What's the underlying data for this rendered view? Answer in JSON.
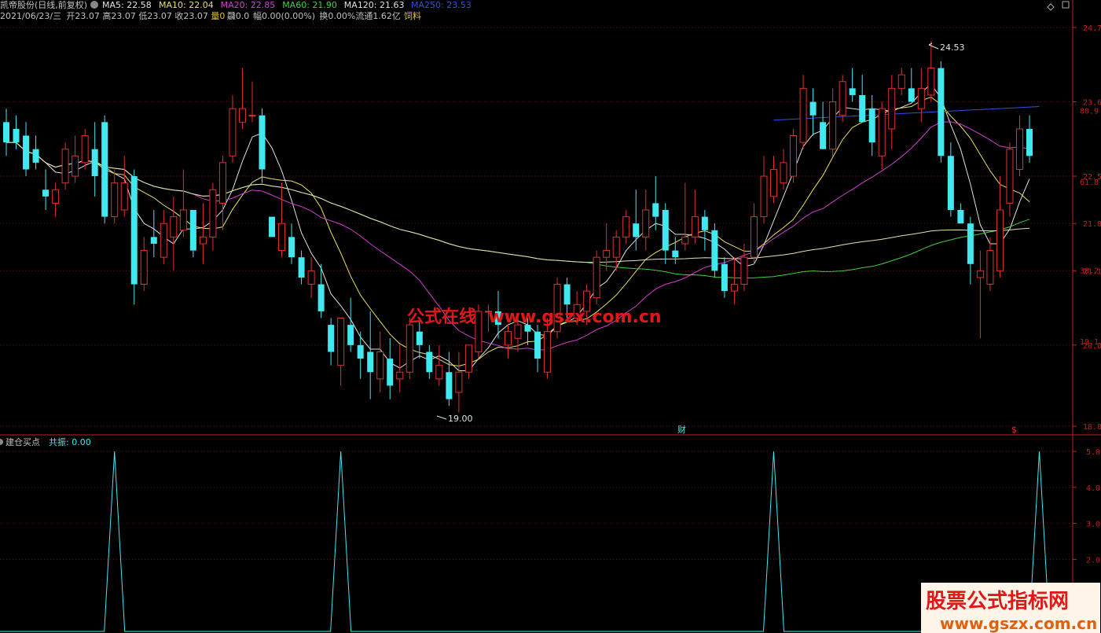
{
  "header": {
    "title": "凯帝股份(日线,前复权)",
    "ma_values": [
      {
        "label": "MA5: 22.58",
        "color": "#e0e0e0"
      },
      {
        "label": "MA10: 22.04",
        "color": "#e8e060"
      },
      {
        "label": "MA20: 22.85",
        "color": "#d040d0"
      },
      {
        "label": "MA60: 21.90",
        "color": "#40d040"
      },
      {
        "label": "MA120: 21.63",
        "color": "#e0e0e0"
      },
      {
        "label": "MA250: 23.53",
        "color": "#3050e0"
      }
    ],
    "info_line": [
      {
        "text": "2021/06/23/三",
        "color": "#c0c0c0"
      },
      {
        "text": "开23.07",
        "color": "#c0c0c0"
      },
      {
        "text": "高23.07",
        "color": "#c0c0c0"
      },
      {
        "text": "低23.07",
        "color": "#c0c0c0"
      },
      {
        "text": "收23.07",
        "color": "#c0c0c0"
      },
      {
        "text": "量0",
        "color": "#e0c040"
      },
      {
        "text": "飝0.0",
        "color": "#c0c0c0"
      },
      {
        "text": "幅0.00(0.00%)",
        "color": "#c0c0c0"
      },
      {
        "text": "换0.00%",
        "color": "#c0c0c0"
      },
      {
        "text": "流通1.62亿",
        "color": "#c0c0c0"
      },
      {
        "text": "饲料",
        "color": "#e0c040"
      }
    ]
  },
  "indicator": {
    "name": "建仓买点",
    "value_text": "共振: 0.00"
  },
  "annotations": {
    "high_label": "24.53",
    "low_label": "19.00",
    "finance_marker": "财",
    "dollar_marker": "$",
    "watermark_center": "公式在线  www.gszx.com.cn",
    "watermark_corner_title": "股票公式指标网",
    "watermark_corner_url": "www.gszx.com.cn"
  },
  "colors": {
    "up": "#e03030",
    "down": "#40e8f0",
    "grid": "#701010",
    "axis": "#c81e1e"
  },
  "chart_data": [
    {
      "type": "candlestick",
      "price_axis_ticks": [
        "24.7",
        "23.6",
        "22.5",
        "21.8",
        "21.1",
        "20.0",
        "18.8"
      ],
      "fib_ticks": [
        "80.9",
        "61.8",
        "38.2",
        "19.1"
      ],
      "ylim": [
        18.8,
        24.7
      ],
      "candles": [
        {
          "o": 23.3,
          "h": 23.5,
          "l": 22.8,
          "c": 23.0
        },
        {
          "o": 23.2,
          "h": 23.4,
          "l": 22.9,
          "c": 23.0
        },
        {
          "o": 23.1,
          "h": 23.3,
          "l": 22.5,
          "c": 22.6
        },
        {
          "o": 22.9,
          "h": 23.1,
          "l": 22.6,
          "c": 22.7
        },
        {
          "o": 22.3,
          "h": 22.6,
          "l": 22.0,
          "c": 22.2
        },
        {
          "o": 22.1,
          "h": 22.4,
          "l": 21.9,
          "c": 22.3
        },
        {
          "o": 22.4,
          "h": 23.0,
          "l": 22.3,
          "c": 22.9
        },
        {
          "o": 22.5,
          "h": 23.1,
          "l": 22.4,
          "c": 22.8
        },
        {
          "o": 22.7,
          "h": 23.2,
          "l": 22.6,
          "c": 23.1
        },
        {
          "o": 22.9,
          "h": 23.3,
          "l": 22.2,
          "c": 22.5
        },
        {
          "o": 23.3,
          "h": 23.4,
          "l": 21.8,
          "c": 21.9
        },
        {
          "o": 21.9,
          "h": 22.6,
          "l": 21.8,
          "c": 22.4
        },
        {
          "o": 22.0,
          "h": 22.8,
          "l": 21.9,
          "c": 22.4
        },
        {
          "o": 22.5,
          "h": 22.6,
          "l": 20.6,
          "c": 20.9
        },
        {
          "o": 20.9,
          "h": 21.6,
          "l": 20.8,
          "c": 21.4
        },
        {
          "o": 21.6,
          "h": 22.0,
          "l": 21.3,
          "c": 21.5
        },
        {
          "o": 21.3,
          "h": 22.0,
          "l": 21.2,
          "c": 21.8
        },
        {
          "o": 21.6,
          "h": 22.2,
          "l": 21.1,
          "c": 21.9
        },
        {
          "o": 21.7,
          "h": 22.6,
          "l": 21.6,
          "c": 22.0
        },
        {
          "o": 22.0,
          "h": 22.0,
          "l": 21.3,
          "c": 21.4
        },
        {
          "o": 21.5,
          "h": 22.1,
          "l": 21.2,
          "c": 21.6
        },
        {
          "o": 21.6,
          "h": 22.4,
          "l": 21.4,
          "c": 22.3
        },
        {
          "o": 22.1,
          "h": 22.8,
          "l": 21.7,
          "c": 22.7
        },
        {
          "o": 22.8,
          "h": 23.7,
          "l": 22.7,
          "c": 23.5
        },
        {
          "o": 23.3,
          "h": 24.1,
          "l": 23.2,
          "c": 23.5
        },
        {
          "o": 23.4,
          "h": 23.9,
          "l": 23.3,
          "c": 23.4
        },
        {
          "o": 23.4,
          "h": 23.5,
          "l": 22.4,
          "c": 22.6
        },
        {
          "o": 21.9,
          "h": 21.9,
          "l": 21.6,
          "c": 21.6
        },
        {
          "o": 21.4,
          "h": 22.4,
          "l": 21.3,
          "c": 21.8
        },
        {
          "o": 21.6,
          "h": 21.8,
          "l": 21.2,
          "c": 21.3
        },
        {
          "o": 21.3,
          "h": 21.4,
          "l": 20.9,
          "c": 21.0
        },
        {
          "o": 20.9,
          "h": 21.3,
          "l": 20.7,
          "c": 21.1
        },
        {
          "o": 20.9,
          "h": 21.2,
          "l": 20.4,
          "c": 20.5
        },
        {
          "o": 20.3,
          "h": 20.4,
          "l": 19.7,
          "c": 19.9
        },
        {
          "o": 19.7,
          "h": 20.4,
          "l": 19.4,
          "c": 20.4
        },
        {
          "o": 20.3,
          "h": 20.7,
          "l": 19.9,
          "c": 20.0
        },
        {
          "o": 20.0,
          "h": 20.2,
          "l": 19.5,
          "c": 19.8
        },
        {
          "o": 19.9,
          "h": 20.5,
          "l": 19.2,
          "c": 19.6
        },
        {
          "o": 19.5,
          "h": 20.2,
          "l": 19.3,
          "c": 19.9
        },
        {
          "o": 19.8,
          "h": 20.1,
          "l": 19.2,
          "c": 19.4
        },
        {
          "o": 19.5,
          "h": 20.0,
          "l": 19.3,
          "c": 19.6
        },
        {
          "o": 19.6,
          "h": 20.4,
          "l": 19.5,
          "c": 20.3
        },
        {
          "o": 20.2,
          "h": 20.4,
          "l": 19.8,
          "c": 20.0
        },
        {
          "o": 19.9,
          "h": 20.0,
          "l": 19.5,
          "c": 19.6
        },
        {
          "o": 19.5,
          "h": 20.0,
          "l": 19.4,
          "c": 19.7
        },
        {
          "o": 19.6,
          "h": 19.9,
          "l": 19.1,
          "c": 19.2
        },
        {
          "o": 19.3,
          "h": 19.9,
          "l": 19.0,
          "c": 19.6
        },
        {
          "o": 19.6,
          "h": 20.0,
          "l": 19.5,
          "c": 20.0
        },
        {
          "o": 19.9,
          "h": 20.6,
          "l": 19.8,
          "c": 20.5
        },
        {
          "o": 20.5,
          "h": 20.6,
          "l": 20.2,
          "c": 20.5
        },
        {
          "o": 20.5,
          "h": 20.8,
          "l": 20.1,
          "c": 20.3
        },
        {
          "o": 20.0,
          "h": 20.3,
          "l": 19.8,
          "c": 20.2
        },
        {
          "o": 20.1,
          "h": 20.4,
          "l": 19.9,
          "c": 20.3
        },
        {
          "o": 20.3,
          "h": 20.4,
          "l": 20.0,
          "c": 20.2
        },
        {
          "o": 20.2,
          "h": 20.3,
          "l": 19.6,
          "c": 19.8
        },
        {
          "o": 19.6,
          "h": 20.4,
          "l": 19.5,
          "c": 20.2
        },
        {
          "o": 20.2,
          "h": 21.0,
          "l": 20.1,
          "c": 20.9
        },
        {
          "o": 20.9,
          "h": 21.0,
          "l": 20.4,
          "c": 20.6
        },
        {
          "o": 20.4,
          "h": 20.8,
          "l": 20.3,
          "c": 20.6
        },
        {
          "o": 20.5,
          "h": 20.9,
          "l": 20.3,
          "c": 20.8
        },
        {
          "o": 20.7,
          "h": 21.4,
          "l": 20.6,
          "c": 21.3
        },
        {
          "o": 21.3,
          "h": 21.8,
          "l": 21.1,
          "c": 21.4
        },
        {
          "o": 21.3,
          "h": 21.7,
          "l": 21.1,
          "c": 21.6
        },
        {
          "o": 21.6,
          "h": 22.0,
          "l": 21.5,
          "c": 21.9
        },
        {
          "o": 21.8,
          "h": 22.3,
          "l": 21.4,
          "c": 21.6
        },
        {
          "o": 21.6,
          "h": 22.3,
          "l": 21.4,
          "c": 22.0
        },
        {
          "o": 22.1,
          "h": 22.5,
          "l": 21.7,
          "c": 21.9
        },
        {
          "o": 22.0,
          "h": 22.1,
          "l": 21.2,
          "c": 21.4
        },
        {
          "o": 21.4,
          "h": 21.6,
          "l": 21.2,
          "c": 21.3
        },
        {
          "o": 21.5,
          "h": 22.4,
          "l": 21.4,
          "c": 21.6
        },
        {
          "o": 21.6,
          "h": 22.3,
          "l": 21.5,
          "c": 21.9
        },
        {
          "o": 21.9,
          "h": 22.0,
          "l": 21.4,
          "c": 21.7
        },
        {
          "o": 21.7,
          "h": 21.8,
          "l": 21.0,
          "c": 21.1
        },
        {
          "o": 21.2,
          "h": 21.3,
          "l": 20.7,
          "c": 20.8
        },
        {
          "o": 20.8,
          "h": 21.3,
          "l": 20.6,
          "c": 20.9
        },
        {
          "o": 20.9,
          "h": 21.5,
          "l": 20.8,
          "c": 21.3
        },
        {
          "o": 21.3,
          "h": 22.1,
          "l": 21.2,
          "c": 21.9
        },
        {
          "o": 21.9,
          "h": 22.8,
          "l": 21.8,
          "c": 22.5
        },
        {
          "o": 22.2,
          "h": 22.8,
          "l": 22.1,
          "c": 22.6
        },
        {
          "o": 22.4,
          "h": 22.9,
          "l": 22.3,
          "c": 22.7
        },
        {
          "o": 22.5,
          "h": 23.2,
          "l": 22.4,
          "c": 23.1
        },
        {
          "o": 23.0,
          "h": 24.0,
          "l": 22.9,
          "c": 23.8
        },
        {
          "o": 23.6,
          "h": 23.8,
          "l": 23.1,
          "c": 23.4
        },
        {
          "o": 23.3,
          "h": 23.6,
          "l": 22.9,
          "c": 22.9
        },
        {
          "o": 22.9,
          "h": 23.8,
          "l": 22.8,
          "c": 23.6
        },
        {
          "o": 23.4,
          "h": 24.0,
          "l": 23.3,
          "c": 23.9
        },
        {
          "o": 23.8,
          "h": 24.1,
          "l": 23.6,
          "c": 23.7
        },
        {
          "o": 23.7,
          "h": 24.0,
          "l": 23.3,
          "c": 23.3
        },
        {
          "o": 23.5,
          "h": 23.7,
          "l": 22.8,
          "c": 23.0
        },
        {
          "o": 22.8,
          "h": 23.6,
          "l": 22.6,
          "c": 23.5
        },
        {
          "o": 23.2,
          "h": 24.0,
          "l": 22.9,
          "c": 23.8
        },
        {
          "o": 23.8,
          "h": 24.1,
          "l": 23.7,
          "c": 24.0
        },
        {
          "o": 23.8,
          "h": 24.1,
          "l": 23.6,
          "c": 23.6
        },
        {
          "o": 23.5,
          "h": 24.1,
          "l": 23.3,
          "c": 23.8
        },
        {
          "o": 23.7,
          "h": 24.5,
          "l": 23.6,
          "c": 24.1
        },
        {
          "o": 24.1,
          "h": 24.2,
          "l": 22.7,
          "c": 22.8
        },
        {
          "o": 22.8,
          "h": 23.0,
          "l": 21.9,
          "c": 22.0
        },
        {
          "o": 22.0,
          "h": 22.1,
          "l": 21.8,
          "c": 21.8
        },
        {
          "o": 21.8,
          "h": 21.9,
          "l": 20.9,
          "c": 21.2
        },
        {
          "o": 21.0,
          "h": 21.4,
          "l": 20.1,
          "c": 21.1
        },
        {
          "o": 20.9,
          "h": 21.6,
          "l": 20.8,
          "c": 21.4
        },
        {
          "o": 21.1,
          "h": 22.5,
          "l": 21.0,
          "c": 22.0
        },
        {
          "o": 22.1,
          "h": 23.0,
          "l": 21.9,
          "c": 22.9
        },
        {
          "o": 22.6,
          "h": 23.4,
          "l": 22.5,
          "c": 23.2
        },
        {
          "o": 23.2,
          "h": 23.4,
          "l": 22.7,
          "c": 22.8
        }
      ]
    },
    {
      "type": "line",
      "name": "共振",
      "yticks": [
        "5.0",
        "4.0",
        "3.0",
        "2.0"
      ],
      "ylim": [
        0,
        5
      ],
      "spikes_at_index": [
        11,
        34,
        78,
        105
      ],
      "spike_value": 5
    }
  ]
}
